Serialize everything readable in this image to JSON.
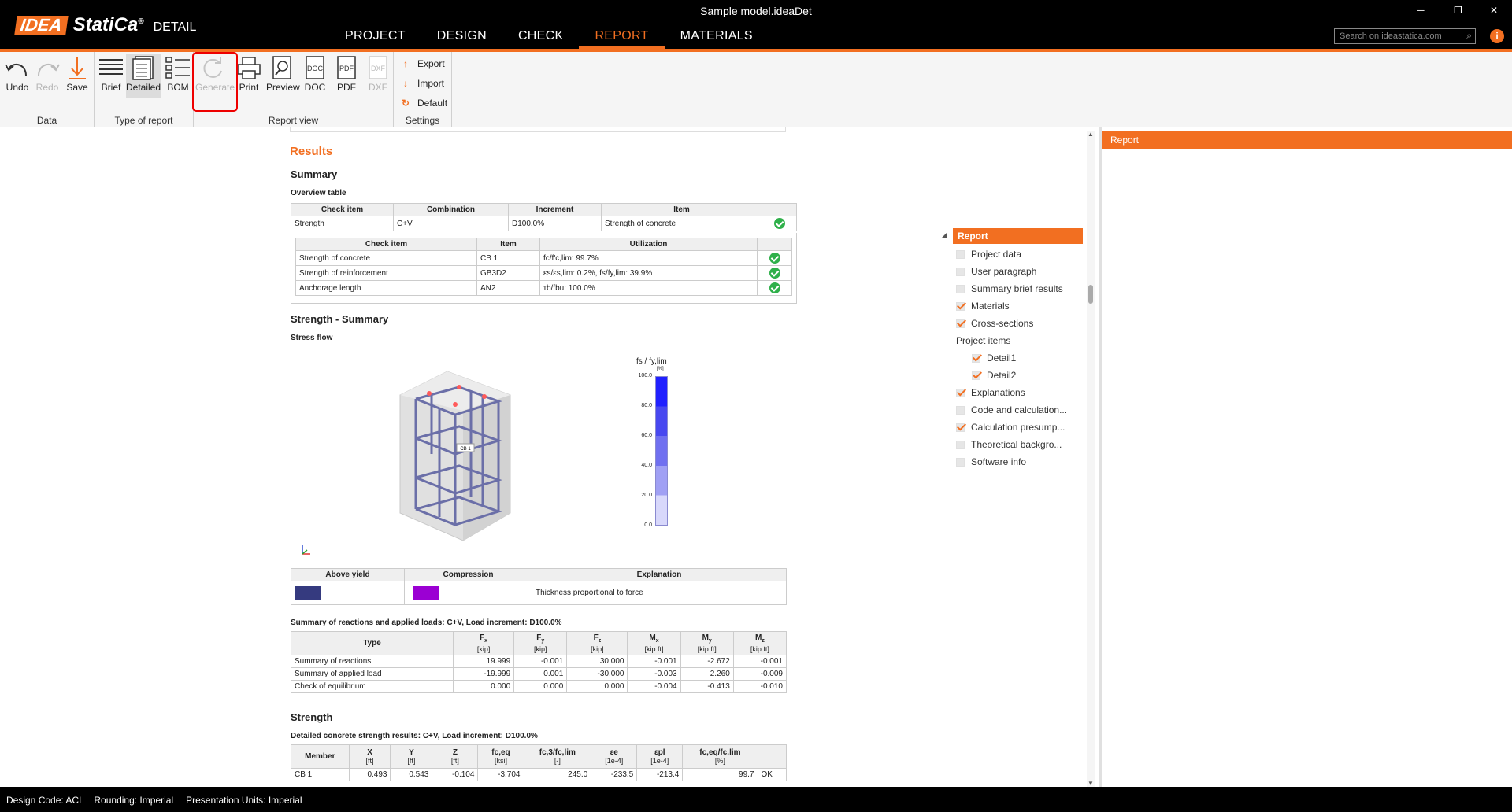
{
  "window": {
    "title": "Sample model.ideaDet",
    "minimize": "─",
    "maximize": "❐",
    "close": "✕"
  },
  "logo": {
    "brand": "IDEA",
    "product": "StatiCa",
    "reg": "®",
    "module": "DETAIL"
  },
  "nav": {
    "tabs": [
      "PROJECT",
      "DESIGN",
      "CHECK",
      "REPORT",
      "MATERIALS"
    ],
    "active": "REPORT"
  },
  "search": {
    "placeholder": "Search on ideastatica.com",
    "icon": "search-icon"
  },
  "info": {
    "label": "i",
    "icon": "info-icon"
  },
  "ribbon": {
    "data": {
      "label": "Data",
      "undo": "Undo",
      "redo": "Redo",
      "save": "Save"
    },
    "type_of_report": {
      "label": "Type of report",
      "brief": "Brief",
      "detailed": "Detailed",
      "bom": "BOM"
    },
    "report_view": {
      "label": "Report view",
      "generate": "Generate",
      "print": "Print",
      "preview": "Preview",
      "doc": "DOC",
      "pdf": "PDF",
      "dxf": "DXF"
    },
    "settings": {
      "label": "Settings",
      "export": "Export",
      "import": "Import",
      "default": "Default"
    }
  },
  "report": {
    "results": "Results",
    "summary": "Summary",
    "overview_table": "Overview table",
    "overview": {
      "headers": [
        "Check item",
        "Combination",
        "Increment",
        "Item"
      ],
      "row": [
        "Strength",
        "C+V",
        "D100.0%",
        "Strength of concrete"
      ]
    },
    "checks": {
      "headers": [
        "Check item",
        "Item",
        "Utilization"
      ],
      "rows": [
        [
          "Strength of concrete",
          "CB 1",
          "fc/f'c,lim: 99.7%"
        ],
        [
          "Strength of reinforcement",
          "GB3D2",
          "εs/εs,lim: 0.2%, fs/fy,lim: 39.9%"
        ],
        [
          "Anchorage length",
          "AN2",
          "τb/fbu: 100.0%"
        ]
      ]
    },
    "strength_summary": "Strength - Summary",
    "stress_flow": "Stress flow",
    "member_label": "CB 1",
    "scale": {
      "title": "fs / fy,lim",
      "unit": "[%]",
      "ticks": [
        "100.0",
        "80.0",
        "60.0",
        "40.0",
        "20.0",
        "0.0"
      ]
    },
    "legend": {
      "headers": [
        "Above yield",
        "Compression",
        "Explanation"
      ],
      "colors": [
        "#353a7f",
        "#9b00d3"
      ],
      "explanation": "Thickness proportional to force"
    },
    "reactions_title": "Summary of reactions and applied loads: C+V, Load increment: D100.0%",
    "reactions": {
      "type_header": "Type",
      "headers": [
        [
          "F",
          "x",
          "[kip]"
        ],
        [
          "F",
          "y",
          "[kip]"
        ],
        [
          "F",
          "z",
          "[kip]"
        ],
        [
          "M",
          "x",
          "[kip.ft]"
        ],
        [
          "M",
          "y",
          "[kip.ft]"
        ],
        [
          "M",
          "z",
          "[kip.ft]"
        ]
      ],
      "rows": [
        [
          "Summary of reactions",
          "19.999",
          "-0.001",
          "30.000",
          "-0.001",
          "-2.672",
          "-0.001"
        ],
        [
          "Summary of applied load",
          "-19.999",
          "0.001",
          "-30.000",
          "-0.003",
          "2.260",
          "-0.009"
        ],
        [
          "Check of equilibrium",
          "0.000",
          "0.000",
          "0.000",
          "-0.004",
          "-0.413",
          "-0.010"
        ]
      ]
    },
    "strength": "Strength",
    "concrete_title": "Detailed concrete strength results: C+V, Load increment: D100.0%",
    "concrete": {
      "headers": [
        [
          "Member",
          ""
        ],
        [
          "X",
          "[ft]"
        ],
        [
          "Y",
          "[ft]"
        ],
        [
          "Z",
          "[ft]"
        ],
        [
          "fc,eq",
          "[ksi]"
        ],
        [
          "fc,3/fc,lim",
          "[-]"
        ],
        [
          "εe",
          "[1e-4]"
        ],
        [
          "εpl",
          "[1e-4]"
        ],
        [
          "fc,eq/fc,lim",
          "[%]"
        ],
        [
          "",
          ""
        ]
      ],
      "row": [
        "CB 1",
        "0.493",
        "0.543",
        "-0.104",
        "-3.704",
        "245.0",
        "-233.5",
        "-213.4",
        "99.7",
        "OK"
      ]
    }
  },
  "panel": {
    "header": "Report",
    "root": "Report",
    "items": [
      {
        "label": "Project data",
        "checked": false,
        "indent": 0
      },
      {
        "label": "User paragraph",
        "checked": false,
        "indent": 0
      },
      {
        "label": "Summary brief results",
        "checked": false,
        "indent": 0
      },
      {
        "label": "Materials",
        "checked": true,
        "indent": 0
      },
      {
        "label": "Cross-sections",
        "checked": true,
        "indent": 0
      },
      {
        "label": "Project items",
        "checked": null,
        "indent": 0
      },
      {
        "label": "Detail1",
        "checked": true,
        "indent": 1
      },
      {
        "label": "Detail2",
        "checked": true,
        "indent": 1
      },
      {
        "label": "Explanations",
        "checked": true,
        "indent": 0
      },
      {
        "label": "Code and calculation...",
        "checked": false,
        "indent": 0
      },
      {
        "label": "Calculation presump...",
        "checked": true,
        "indent": 0
      },
      {
        "label": "Theoretical backgro...",
        "checked": false,
        "indent": 0
      },
      {
        "label": "Software info",
        "checked": false,
        "indent": 0
      }
    ]
  },
  "status": {
    "design_code": "Design Code: ACI",
    "rounding": "Rounding: Imperial",
    "units": "Presentation Units: Imperial"
  }
}
